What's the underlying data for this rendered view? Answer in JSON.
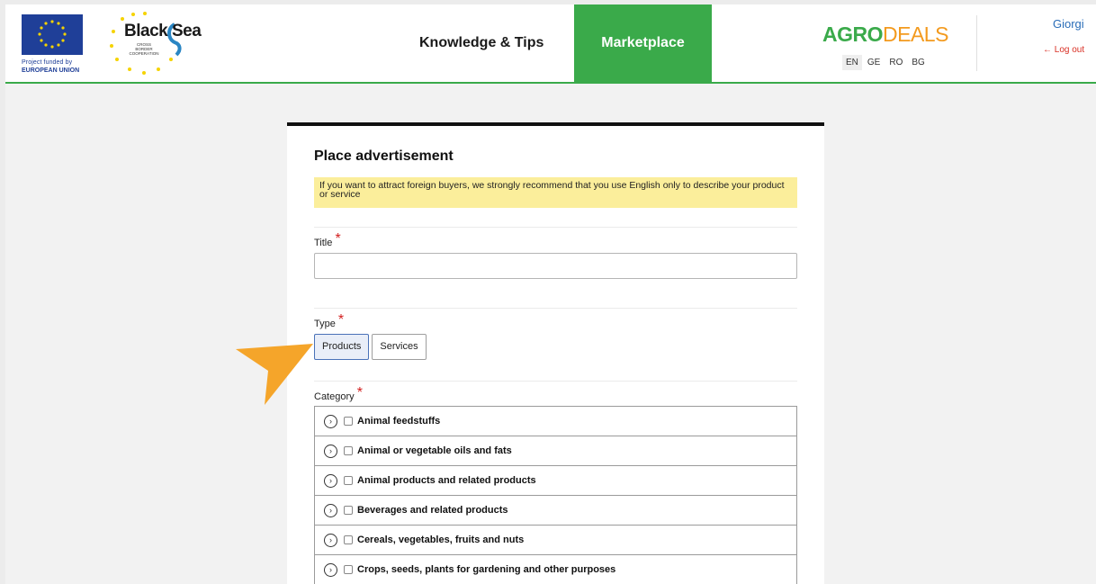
{
  "header": {
    "eu_text_1": "Project funded by",
    "eu_text_2": "EUROPEAN UNION",
    "blacksea_title": "Black Sea",
    "blacksea_subtitle": "CROSS BORDER COOPERATION",
    "nav_knowledge": "Knowledge & Tips",
    "nav_marketplace": "Marketplace",
    "brand_part1": "AGRO",
    "brand_part2": "DEALS",
    "languages": [
      "EN",
      "GE",
      "RO",
      "BG"
    ],
    "active_language": "EN",
    "user_name": "Giorgi",
    "logout": "← Log out"
  },
  "form": {
    "heading": "Place advertisement",
    "notice": "If you want to attract foreign buyers, we strongly recommend that you use English only to describe your product or service",
    "title_label": "Title",
    "title_value": "",
    "type_label": "Type",
    "type_options": [
      "Products",
      "Services"
    ],
    "type_selected": "Products",
    "category_label": "Category",
    "required_mark": "*",
    "categories": [
      "Animal feedstuffs",
      "Animal or vegetable oils and fats",
      "Animal products and related products",
      "Beverages and related products",
      "Cereals, vegetables, fruits and nuts",
      "Crops, seeds, plants for gardening and other purposes"
    ]
  },
  "colors": {
    "brand_green": "#3aaa4a",
    "brand_orange": "#f39a1e",
    "notice_yellow": "#fbee9b",
    "logout_red": "#d93025",
    "user_blue": "#2a6db8"
  }
}
